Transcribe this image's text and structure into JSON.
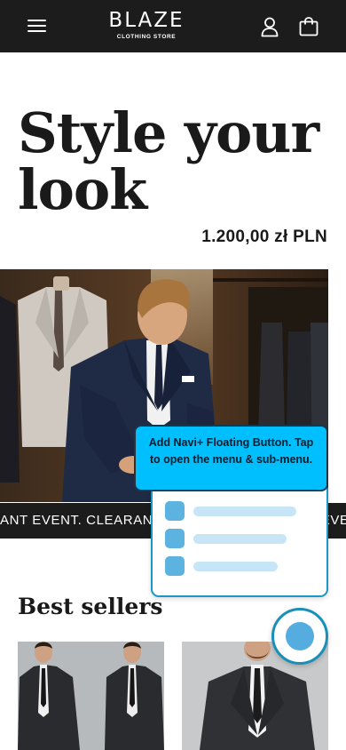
{
  "header": {
    "brand_name": "BLAZE",
    "brand_tagline": "CLOTHING STORE",
    "icons": [
      "menu-icon",
      "account-icon",
      "cart-icon"
    ]
  },
  "hero": {
    "title": "Style your look",
    "price": "1.200,00 zł PLN",
    "image": "man-in-navy-suit-in-tailor-shop"
  },
  "marquee": {
    "text": "ANT EVENT.   CLEARANCE EVENT.   CLEARANCE EVENT.   CLEARANCE EVENT."
  },
  "best_sellers": {
    "title": "Best sellers",
    "products": [
      "charcoal-suit-two-views",
      "three-piece-suit-model"
    ]
  },
  "navi_plus": {
    "tooltip": "Add Navi+ Floating Button. Tap to open the menu & sub-menu.",
    "menu_item_count": 3,
    "colors": {
      "accent": "#00bfff",
      "border": "#1a97c7",
      "dot": "#5db3e0",
      "bar": "#c6e6f7"
    }
  }
}
